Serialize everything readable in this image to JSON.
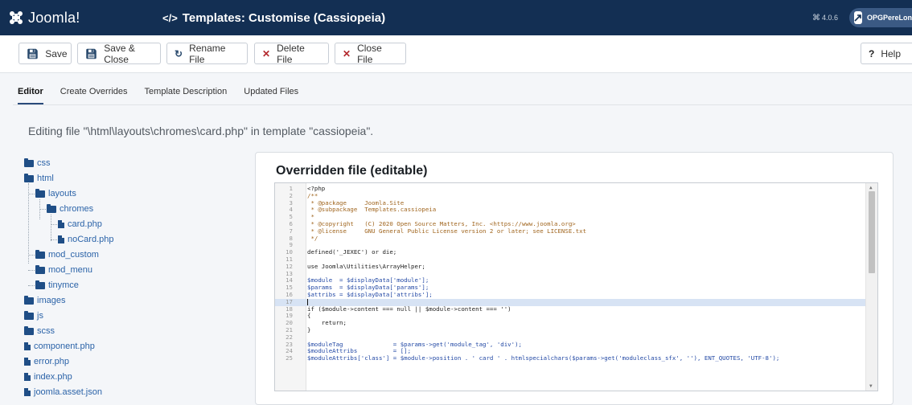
{
  "header": {
    "brand": "Joomla!",
    "title": "Templates: Customise (Cassiopeia)",
    "version": "4.0.6",
    "site_name": "OPGPereLonca"
  },
  "toolbar": {
    "save": "Save",
    "save_close": "Save & Close",
    "rename": "Rename File",
    "delete": "Delete File",
    "close": "Close File",
    "help": "Help"
  },
  "tabs": [
    {
      "label": "Editor",
      "active": true
    },
    {
      "label": "Create Overrides",
      "active": false
    },
    {
      "label": "Template Description",
      "active": false
    },
    {
      "label": "Updated Files",
      "active": false
    }
  ],
  "editing_text": "Editing file \"\\html\\layouts\\chromes\\card.php\" in template \"cassiopeia\".",
  "tree": {
    "css": "css",
    "html": "html",
    "layouts": "layouts",
    "chromes": "chromes",
    "card": "card.php",
    "nocard": "noCard.php",
    "mod_custom": "mod_custom",
    "mod_menu": "mod_menu",
    "tinymce": "tinymce",
    "images": "images",
    "js": "js",
    "scss": "scss",
    "component": "component.php",
    "error": "error.php",
    "index": "index.php",
    "asset": "joomla.asset.json"
  },
  "editor": {
    "title": "Overridden file (editable)",
    "lines": [
      {
        "n": "1",
        "t": "<?php"
      },
      {
        "n": "2",
        "t": "/**"
      },
      {
        "n": "3",
        "t": " * @package     Joomla.Site"
      },
      {
        "n": "4",
        "t": " * @subpackage  Templates.cassiopeia"
      },
      {
        "n": "5",
        "t": " *"
      },
      {
        "n": "6",
        "t": " * @copyright   (C) 2020 Open Source Matters, Inc. <https://www.joomla.org>"
      },
      {
        "n": "7",
        "t": " * @license     GNU General Public License version 2 or later; see LICENSE.txt"
      },
      {
        "n": "8",
        "t": " */"
      },
      {
        "n": "9",
        "t": ""
      },
      {
        "n": "10",
        "t": "defined('_JEXEC') or die;"
      },
      {
        "n": "11",
        "t": ""
      },
      {
        "n": "12",
        "t": "use Joomla\\Utilities\\ArrayHelper;"
      },
      {
        "n": "13",
        "t": ""
      },
      {
        "n": "14",
        "t": "$module  = $displayData['module'];"
      },
      {
        "n": "15",
        "t": "$params  = $displayData['params'];"
      },
      {
        "n": "16",
        "t": "$attribs = $displayData['attribs'];"
      },
      {
        "n": "17",
        "t": ""
      },
      {
        "n": "18",
        "t": "if ($module->content === null || $module->content === '')"
      },
      {
        "n": "19",
        "t": "{"
      },
      {
        "n": "20",
        "t": "    return;"
      },
      {
        "n": "21",
        "t": "}"
      },
      {
        "n": "22",
        "t": ""
      },
      {
        "n": "23",
        "t": "$moduleTag              = $params->get('module_tag', 'div');"
      },
      {
        "n": "24",
        "t": "$moduleAttribs          = [];"
      },
      {
        "n": "25",
        "t": "$moduleAttribs['class'] = $module->position . ' card ' . htmlspecialchars($params->get('moduleclass_sfx', ''), ENT_QUOTES, 'UTF-8');"
      }
    ]
  }
}
